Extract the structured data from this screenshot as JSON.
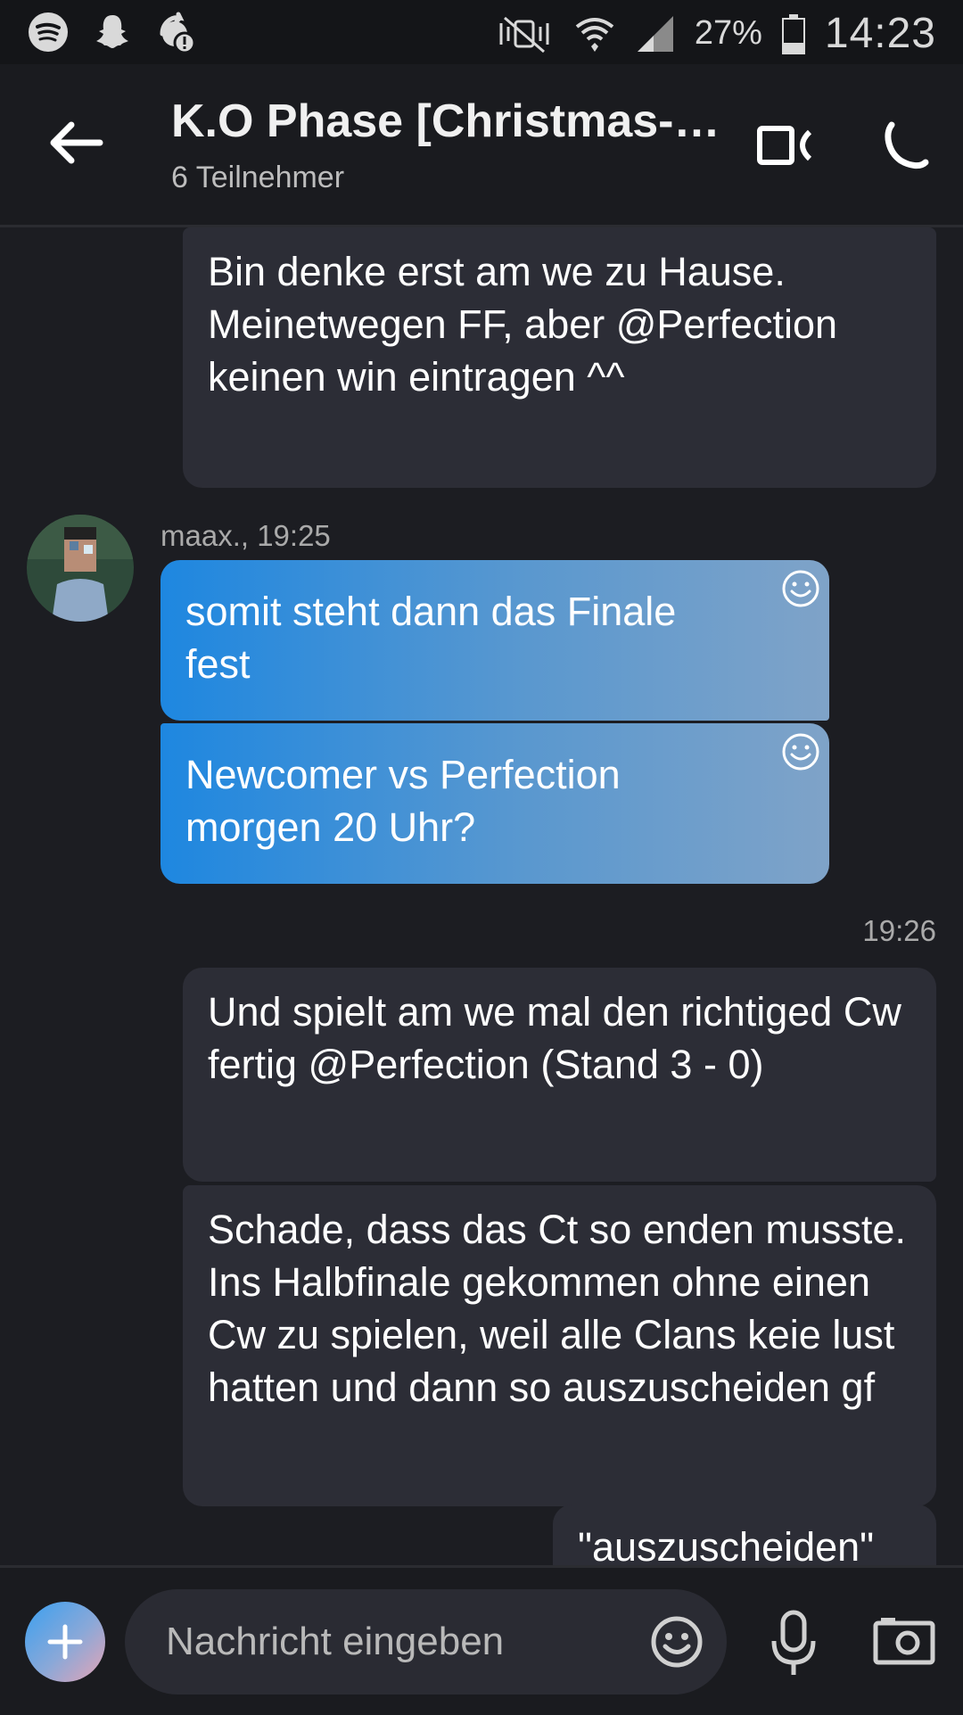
{
  "status_bar": {
    "battery": "27%",
    "time": "14:23",
    "left_icons": [
      "spotify-icon",
      "snapchat-icon",
      "sync-warning-icon"
    ],
    "right_icons": [
      "nfc-mute-icon",
      "wifi-icon",
      "signal-icon",
      "battery-icon"
    ]
  },
  "header": {
    "title": "K.O Phase [Christmas-…",
    "subtitle": "6 Teilnehmer",
    "icons": [
      "back-arrow-icon",
      "video-call-icon",
      "phone-icon"
    ]
  },
  "messages": {
    "m1": "Bin denke erst am we zu Hause. Meinetwegen FF, aber @Perfection keinen win eintragen ^^",
    "sender": "maax., 19:25",
    "m2": "somit steht dann das Finale fest",
    "m3": "Newcomer vs Perfection morgen 20 Uhr?",
    "time2": "19:26",
    "m4": "Und spielt am we mal den richtiged Cw fertig @Perfection (Stand 3 - 0)",
    "m5": "Schade, dass das Ct so enden musste. Ins Halbfinale gekommen ohne einen Cw zu spielen, weil alle Clans keie lust hatten und dann so auszuscheiden gf",
    "m6": "\"auszuscheiden\""
  },
  "composer": {
    "placeholder": "Nachricht eingeben"
  },
  "colors": {
    "background": "#1c1d22",
    "outgoing_bubble": "#2c2d36",
    "incoming_gradient_start": "#1e87e0",
    "incoming_gradient_end": "#7fa3c8"
  }
}
